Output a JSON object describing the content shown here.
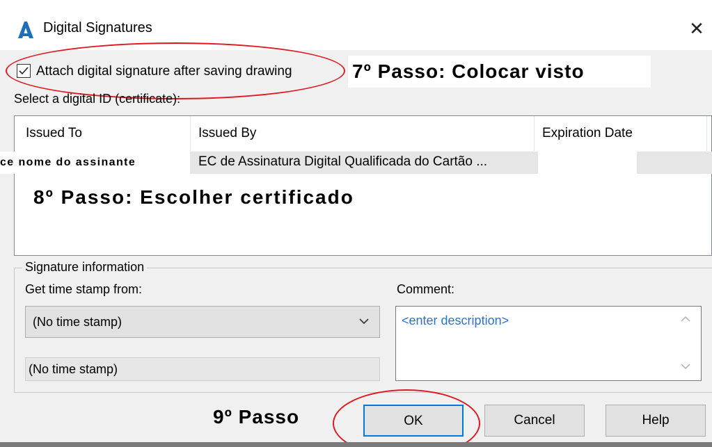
{
  "window": {
    "title": "Digital Signatures",
    "close_glyph": "✕",
    "app_icon": "autocad-a-icon"
  },
  "attach_checkbox": {
    "label": "Attach digital signature after saving drawing",
    "checked": true
  },
  "select_label": "Select a digital ID (certificate):",
  "table": {
    "columns": [
      "Issued To",
      "Issued By",
      "Expiration Date"
    ],
    "rows": [
      {
        "issued_to": "",
        "issued_by": "EC de Assinatura Digital Qualificada do Cartão ...",
        "expiration": ""
      }
    ]
  },
  "annotations": {
    "step7": "7º Passo: Colocar visto",
    "name_overlay": "ce nome do assinante",
    "step8": "8º Passo: Escolher certificado",
    "step9": "9º Passo"
  },
  "signature_info": {
    "group_title": "Signature information",
    "time_stamp_label": "Get time stamp from:",
    "time_stamp_selected": "(No time stamp)",
    "time_stamp_value": "(No time stamp)",
    "comment_label": "Comment:",
    "comment_placeholder": "<enter description>"
  },
  "buttons": {
    "ok": "OK",
    "cancel": "Cancel",
    "help": "Help"
  },
  "colors": {
    "annotation_red": "#e0171f",
    "ok_border": "#0078d7",
    "link_blue": "#2a72d4"
  }
}
